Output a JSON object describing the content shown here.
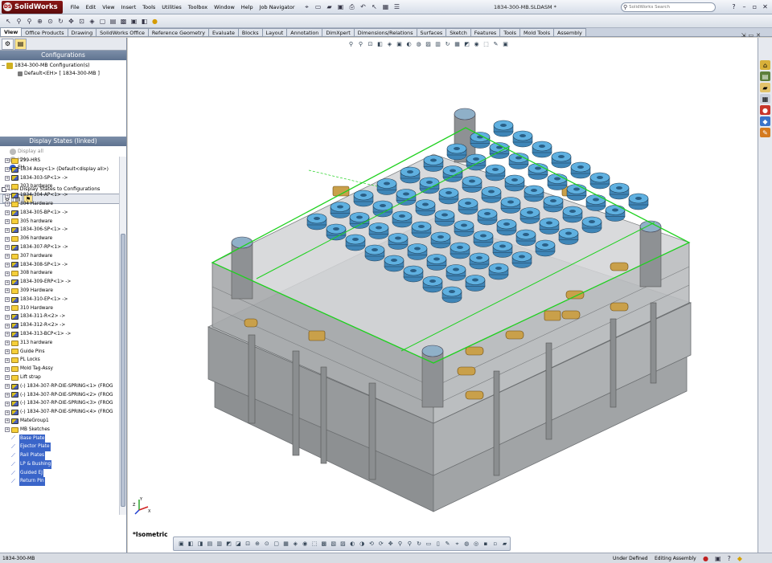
{
  "app": {
    "name": "SolidWorks",
    "logo_mark": "DS"
  },
  "menus": [
    "File",
    "Edit",
    "View",
    "Insert",
    "Tools",
    "Utilities",
    "Toolbox",
    "Window",
    "Help",
    "Job Navigator"
  ],
  "document_title": "1834-300-MB.SLDASM *",
  "search": {
    "placeholder": "SolidWorks Search"
  },
  "command_tabs": [
    "View",
    "Office Products",
    "Drawing",
    "SolidWorks Office",
    "Reference Geometry",
    "Evaluate",
    "Blocks",
    "Layout",
    "Annotation",
    "DimXpert",
    "Dimensions/Relations",
    "Surfaces",
    "Sketch",
    "Features",
    "Tools",
    "Mold Tools",
    "Assembly"
  ],
  "active_tab": "View",
  "configurations": {
    "header": "Configurations",
    "root": "1834-300-MB Configuration(s)",
    "active": "Default<EH> [ 1834-300-MB ]"
  },
  "display_states": {
    "header": "Display States (linked)",
    "items": [
      "Display all",
      "HH",
      "EH"
    ],
    "active": "EH",
    "link_label": "Link Display States to Configurations"
  },
  "tree": [
    {
      "label": "299-HRS",
      "type": "folder"
    },
    {
      "label": "1834 Assy<1> (Default<display all>)",
      "type": "part"
    },
    {
      "label": "1834-303-SP<1> ->",
      "type": "part"
    },
    {
      "label": "303 hardware",
      "type": "folder"
    },
    {
      "label": "1834-304-AP<1> ->",
      "type": "part"
    },
    {
      "label": "304 Hardware",
      "type": "folder"
    },
    {
      "label": "1834-305-BP<1> ->",
      "type": "part"
    },
    {
      "label": "305 hardware",
      "type": "folder"
    },
    {
      "label": "1834-306-SP<1> ->",
      "type": "part"
    },
    {
      "label": "306 hardware",
      "type": "folder"
    },
    {
      "label": "1834-307-RP<1> ->",
      "type": "part"
    },
    {
      "label": "307 hardware",
      "type": "folder"
    },
    {
      "label": "1834-308-SP<1> ->",
      "type": "part"
    },
    {
      "label": "308 hardware",
      "type": "folder"
    },
    {
      "label": "1834-309-ERP<1> ->",
      "type": "part"
    },
    {
      "label": "309 Hardware",
      "type": "folder"
    },
    {
      "label": "1834-310-EP<1> ->",
      "type": "part"
    },
    {
      "label": "310 Hardware",
      "type": "folder"
    },
    {
      "label": "1834-311-R<2> ->",
      "type": "part"
    },
    {
      "label": "1834-312-R<2> ->",
      "type": "part"
    },
    {
      "label": "1834-313-BCP<1> ->",
      "type": "part"
    },
    {
      "label": "313 hardware",
      "type": "folder"
    },
    {
      "label": "Guide Pins",
      "type": "folder"
    },
    {
      "label": "PL Locks",
      "type": "folder"
    },
    {
      "label": "Mold Tag-Assy",
      "type": "folder"
    },
    {
      "label": "Lift strap",
      "type": "folder"
    },
    {
      "label": "(-) 1834-307-RP-DIE-SPRING<1> (FROG",
      "type": "part"
    },
    {
      "label": "(-) 1834-307-RP-DIE-SPRING<2> (FROG",
      "type": "part"
    },
    {
      "label": "(-) 1834-307-RP-DIE-SPRING<3> (FROG",
      "type": "part"
    },
    {
      "label": "(-) 1834-307-RP-DIE-SPRING<4> (FROG",
      "type": "part"
    },
    {
      "label": "MateGroup1",
      "type": "part"
    },
    {
      "label": "MB Sketches",
      "type": "folder"
    },
    {
      "label": "Base Plate",
      "type": "sketch",
      "selected": true
    },
    {
      "label": "Ejector Plate",
      "type": "sketch",
      "selected": true
    },
    {
      "label": "Rail Plates",
      "type": "sketch",
      "selected": true
    },
    {
      "label": "LP & Bushing",
      "type": "sketch",
      "selected": true
    },
    {
      "label": "Guided EJ",
      "type": "sketch",
      "selected": true
    },
    {
      "label": "Return Pin",
      "type": "sketch",
      "selected": true
    }
  ],
  "view": {
    "name": "*Isometric",
    "triad_axes": [
      "Y",
      "Z",
      "X"
    ]
  },
  "status": {
    "document": "1834-300-MB",
    "definition": "Under Defined",
    "mode": "Editing Assembly"
  },
  "colors": {
    "accent_green": "#1fd11f",
    "core_blue": "#4fa3d6",
    "brass": "#c9a04a",
    "selection_blue": "#3a65c9",
    "plate_gray": "#9da0a2"
  }
}
